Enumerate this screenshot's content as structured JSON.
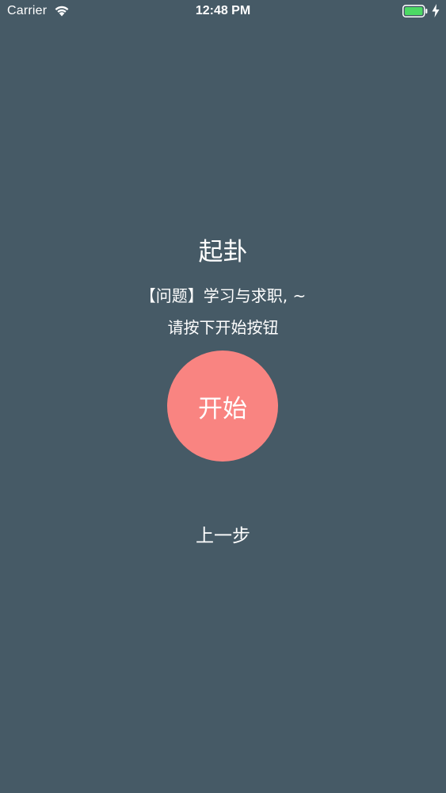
{
  "status_bar": {
    "carrier": "Carrier",
    "time": "12:48 PM",
    "wifi_icon": "wifi-icon",
    "battery_icon": "battery-full-icon",
    "charging_icon": "charging-bolt-icon",
    "battery_color": "#4cd964"
  },
  "screen": {
    "title": "起卦",
    "question": "【问题】学习与求职, ~",
    "prompt": "请按下开始按钮",
    "start_label": "开始",
    "prev_label": "上一步"
  },
  "colors": {
    "background": "#465a66",
    "start_button": "#f98481",
    "text": "#ffffff"
  }
}
